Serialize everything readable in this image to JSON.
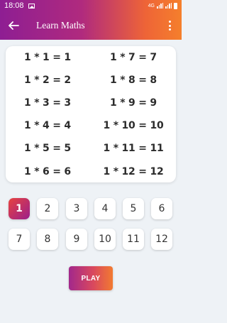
{
  "status_bar": {
    "time": "18:08",
    "network": "4G"
  },
  "toolbar": {
    "title": "Learn Maths"
  },
  "table": {
    "left_column": [
      "1 * 1 = 1",
      "1 * 2 = 2",
      "1 * 3 = 3",
      "1 * 4 = 4",
      "1 * 5 = 5",
      "1 * 6 = 6"
    ],
    "right_column": [
      "1 * 7 = 7",
      "1 * 8 = 8",
      "1 * 9 = 9",
      "1 * 10 = 10",
      "1 * 11 = 11",
      "1 * 12 = 12"
    ]
  },
  "numbers": [
    "1",
    "2",
    "3",
    "4",
    "5",
    "6",
    "7",
    "8",
    "9",
    "10",
    "11",
    "12"
  ],
  "selected_number": "1",
  "play_label": "PLAY",
  "colors": {
    "header_gradient_start": "#8e1e93",
    "header_gradient_end": "#f57f2c",
    "selected_start": "#e7433f",
    "selected_end": "#9b1f8c",
    "background": "#eef2f6"
  }
}
